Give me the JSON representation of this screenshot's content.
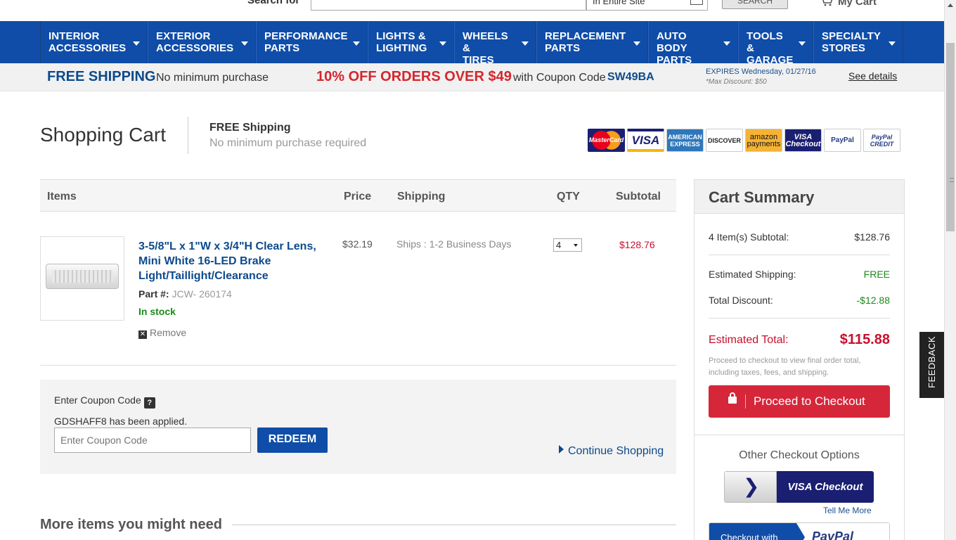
{
  "topbar": {
    "search_label": "Search for",
    "search_scope": "In Entire Site",
    "search_button": "SEARCH",
    "my_cart": "My Cart"
  },
  "nav": [
    {
      "line1": "INTERIOR",
      "line2": "ACCESSORIES"
    },
    {
      "line1": "EXTERIOR",
      "line2": "ACCESSORIES"
    },
    {
      "line1": "PERFORMANCE",
      "line2": "PARTS"
    },
    {
      "line1": "LIGHTS &",
      "line2": "LIGHTING"
    },
    {
      "line1": "WHEELS &",
      "line2": "TIRES"
    },
    {
      "line1": "REPLACEMENT",
      "line2": "PARTS"
    },
    {
      "line1": "AUTO BODY",
      "line2": "PARTS"
    },
    {
      "line1": "TOOLS &",
      "line2": "GARAGE"
    },
    {
      "line1": "SPECIALTY",
      "line2": "STORES"
    }
  ],
  "promo": {
    "free_shipping": "FREE SHIPPING",
    "free_shipping_sub": "No minimum purchase",
    "discount": "10% OFF ORDERS OVER $49",
    "coupon_text": "with Coupon Code",
    "coupon_code": "SW49BA",
    "expires": "EXPIRES Wednesday, 01/27/16",
    "max_discount": "*Max Discount: $50",
    "see_details": "See details"
  },
  "header": {
    "title": "Shopping Cart",
    "shipping_title": "FREE Shipping",
    "shipping_sub": "No minimum purchase required",
    "payments": [
      "MasterCard",
      "VISA",
      "AMERICAN EXPRESS",
      "DISCOVER",
      "amazon payments",
      "VISA Checkout",
      "PayPal",
      "PayPal CREDIT"
    ]
  },
  "table": {
    "headers": {
      "items": "Items",
      "price": "Price",
      "shipping": "Shipping",
      "qty": "QTY",
      "subtotal": "Subtotal"
    }
  },
  "item": {
    "name": "3-5/8\"L x 1\"W x 3/4\"H Clear Lens, Mini White 16-LED Brake Light/Taillight/Clearance",
    "part_label": "Part #:",
    "part_number": "JCW- 260174",
    "stock": "In stock",
    "remove": "Remove",
    "price": "$32.19",
    "shipping": "Ships : 1-2 Business Days",
    "qty": "4",
    "subtotal": "$128.76"
  },
  "coupon": {
    "label": "Enter Coupon Code",
    "help": "?",
    "applied": "GDSHAFF8 has been applied.",
    "placeholder": "Enter Coupon Code",
    "redeem": "REDEEM",
    "continue": "Continue Shopping"
  },
  "more": {
    "title": "More items you might need"
  },
  "summary": {
    "title": "Cart Summary",
    "subtotal_label": "4 Item(s) Subtotal:",
    "subtotal_value": "$128.76",
    "shipping_label": "Estimated Shipping:",
    "shipping_value": "FREE",
    "discount_label": "Total Discount:",
    "discount_value": "-$12.88",
    "total_label": "Estimated Total:",
    "total_value": "$115.88",
    "note": "Proceed to checkout to view final order total, including taxes, fees, and shipping.",
    "checkout": "Proceed to Checkout",
    "other_title": "Other Checkout Options",
    "visa_checkout": "VISA Checkout",
    "tell_more": "Tell Me More",
    "paypal_left": "Checkout with",
    "paypal_right": "PayPal"
  },
  "feedback": "FEEDBACK",
  "colors": {
    "nav_blue": "#0f4da8",
    "price_red": "#c8102e",
    "checkout_red": "#d6263a",
    "discount_green": "#1d8a1d"
  }
}
